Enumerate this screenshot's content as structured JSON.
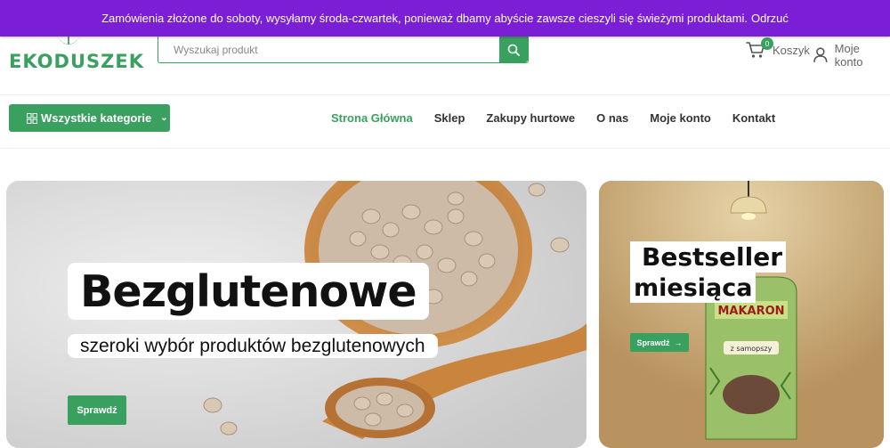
{
  "notice": {
    "text": "Zamówienia złożone do soboty, wysyłamy środa-czwartek, ponieważ dbamy abyście zawsze cieszyli się świeżymi produktami.",
    "dismiss_label": "Odrzuć"
  },
  "header": {
    "logo_text": "EKODUSZEK",
    "search_placeholder": "Wyszukaj produkt",
    "cart_label": "Koszyk",
    "cart_count": "0",
    "account_label": "Moje konto"
  },
  "nav": {
    "categories_label": "Wszystkie kategorie",
    "menu": [
      {
        "label": "Strona Główna",
        "active": true
      },
      {
        "label": "Sklep"
      },
      {
        "label": "Zakupy hurtowe"
      },
      {
        "label": "O nas"
      },
      {
        "label": "Moje konto"
      },
      {
        "label": "Kontakt"
      }
    ]
  },
  "hero": {
    "title": "Bezglutenowe",
    "subtitle": "szeroki wybór produktów bezglutenowych",
    "button_label": "Sprawdź"
  },
  "side_banner": {
    "title_line1": "Bestseller",
    "title_line2": "miesiąca",
    "button_label": "Sprawdź",
    "product_brand": "MAKARON",
    "product_sub": "z samopszy"
  },
  "colors": {
    "accent": "#3aa05f",
    "notice_bg": "#7a1fd6"
  }
}
